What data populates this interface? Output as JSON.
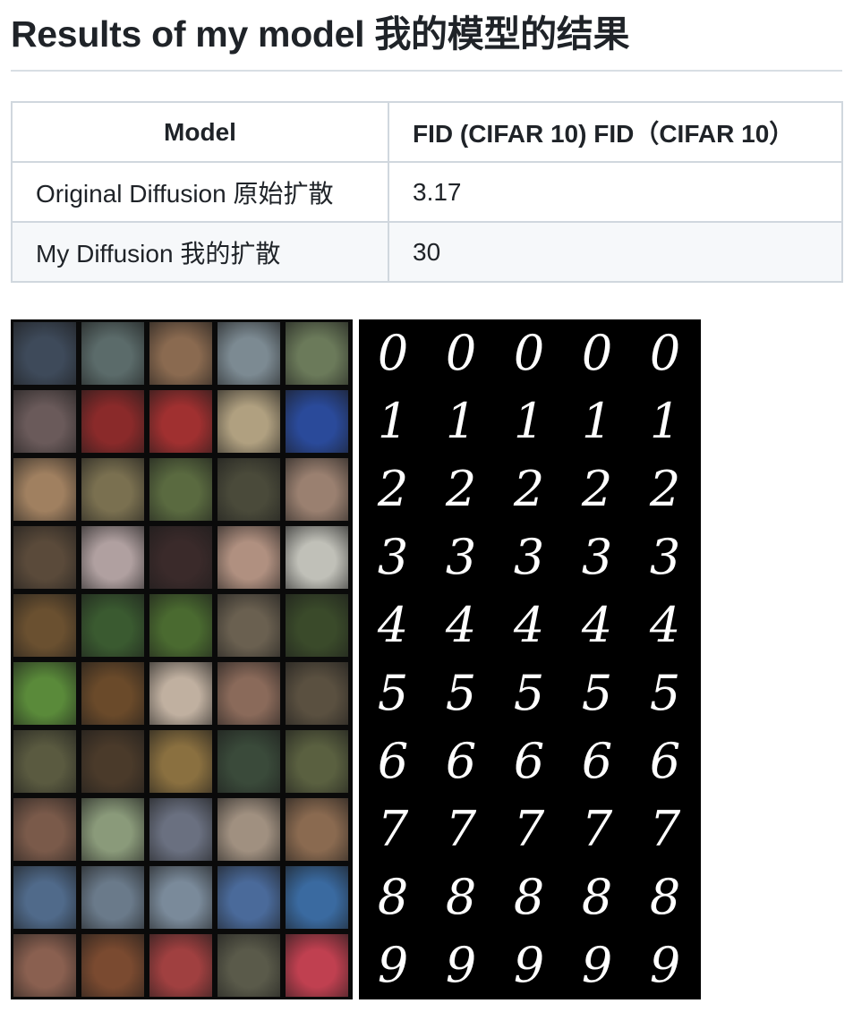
{
  "heading": "Results of my model 我的模型的结果",
  "table": {
    "headers": [
      "Model",
      "FID (CIFAR 10) FID（CIFAR 10）"
    ],
    "rows": [
      [
        "Original Diffusion 原始扩散",
        "3.17"
      ],
      [
        "My Diffusion 我的扩散",
        "30"
      ]
    ]
  },
  "cifar_grid": {
    "rows": 10,
    "cols": 5,
    "row_colors": [
      [
        "#3e4a5a",
        "#5b6b6a",
        "#8a6a50",
        "#7c8a92",
        "#6b7a5a"
      ],
      [
        "#6a5a5a",
        "#8a2a2a",
        "#a03030",
        "#b0a080",
        "#2a4a9a"
      ],
      [
        "#a08060",
        "#7a7050",
        "#5a6a40",
        "#4a4a3a",
        "#9a8070"
      ],
      [
        "#5a4a3a",
        "#b0a0a0",
        "#3a2a2a",
        "#b09080",
        "#c0c0b8"
      ],
      [
        "#6a5030",
        "#3a5a30",
        "#4a6a30",
        "#6a6050",
        "#3a4a2a"
      ],
      [
        "#5a8a3a",
        "#6a4a2a",
        "#c0b0a0",
        "#8a6a5a",
        "#5a5040"
      ],
      [
        "#5a5a40",
        "#4a3a2a",
        "#8a7040",
        "#3a4a3a",
        "#5a6040"
      ],
      [
        "#7a5a4a",
        "#8a9a7a",
        "#6a7080",
        "#a09080",
        "#8a6a50"
      ],
      [
        "#506a8a",
        "#6a7a8a",
        "#7a8a9a",
        "#4a6a9a",
        "#3a6aa0"
      ],
      [
        "#8a6050",
        "#7a4a30",
        "#a04040",
        "#5a5a4a",
        "#c04050"
      ]
    ]
  },
  "mnist_grid": {
    "digits": [
      "0",
      "1",
      "2",
      "3",
      "4",
      "5",
      "6",
      "7",
      "8",
      "9"
    ],
    "per_row": 5
  }
}
